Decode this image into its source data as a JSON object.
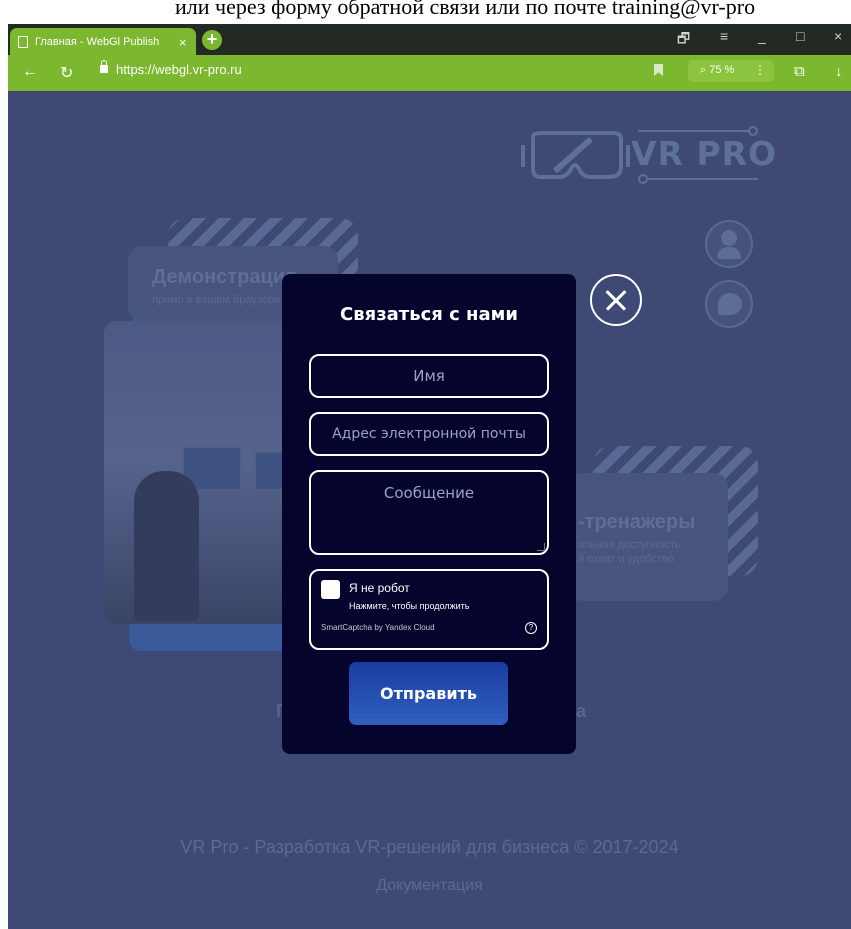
{
  "top_text": "или через форму обратной связи или по почте training@vr-pro",
  "browser": {
    "tab_title": "Главная - WebGl Publish",
    "tab_close": "×",
    "new_tab": "+",
    "back": "←",
    "reload": "↻",
    "url": "https://webgl.vr-pro.ru",
    "zoom": "⌕ 75 %",
    "zoom_menu": "⋮",
    "window_controls": [
      "🗗",
      "≡",
      "_",
      "□",
      "×"
    ],
    "extras": [
      "⧉",
      "↓"
    ]
  },
  "page": {
    "logo_text": "VR PRO",
    "card_demo": {
      "title": "Демонстрация",
      "subtitle": "прямо в вашем браузере"
    },
    "card_trainers": {
      "title": "-тренажеры",
      "line1": "альная доступность,",
      "line2": "й охват и удобство"
    },
    "bg_cta_left": "П",
    "bg_cta_right": "а",
    "footer": "VR Pro - Разработка VR-решений для бизнеса © 2017-2024",
    "footer_link": "Документация"
  },
  "modal": {
    "title": "Связаться с нами",
    "name_placeholder": "Имя",
    "email_placeholder": "Адрес электронной почты",
    "message_placeholder": "Сообщение",
    "captcha": {
      "label": "Я не робот",
      "hint": "Нажмите, чтобы продолжить",
      "provider": "SmartCaptcha by Yandex Cloud",
      "help": "?"
    },
    "submit_label": "Отправить"
  }
}
